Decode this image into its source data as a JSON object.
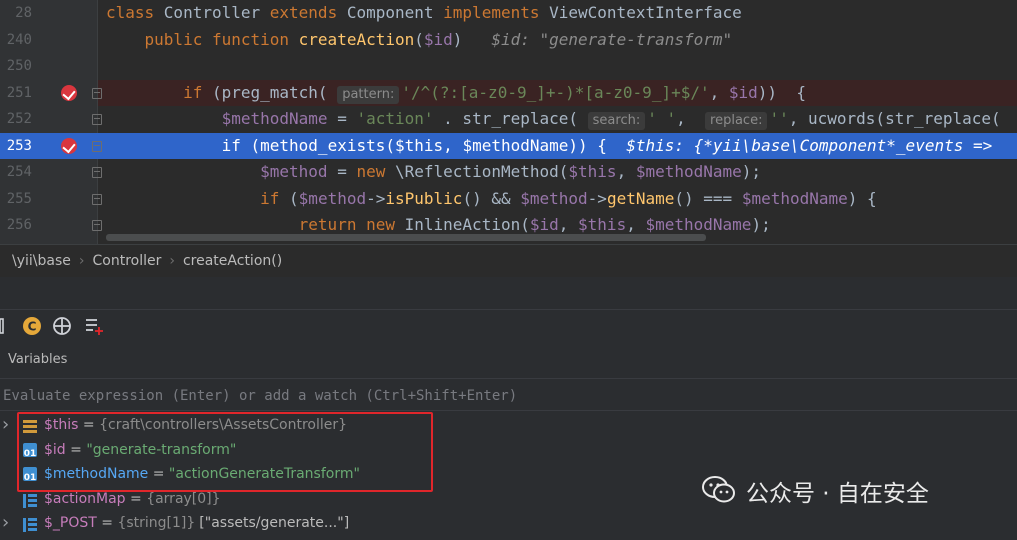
{
  "editor": {
    "lines": [
      {
        "num": "28",
        "parts": [
          [
            "kw",
            "class "
          ],
          [
            "cls",
            "Controller "
          ],
          [
            "kw",
            "extends "
          ],
          [
            "cls",
            "Component "
          ],
          [
            "kw",
            "implements "
          ],
          [
            "cls",
            "ViewContextInterface"
          ]
        ]
      },
      {
        "num": "240",
        "parts": [
          [
            "kw",
            "    public function "
          ],
          [
            "fn",
            "createAction"
          ],
          [
            "cls",
            "("
          ],
          [
            "var",
            "$id"
          ],
          [
            "cls",
            ")"
          ],
          [
            "inline",
            "   $id: \"generate-transform\""
          ]
        ]
      },
      {
        "num": "250",
        "parts": []
      },
      {
        "num": "251",
        "parts": [
          [
            "kw",
            "        if "
          ],
          [
            "cls",
            "(preg_match( "
          ],
          [
            "hint",
            "pattern:"
          ],
          [
            "str",
            "'/^(?:[a-z0-9_]+-)*[a-z0-9_]+$/'"
          ],
          [
            "cls",
            ", "
          ],
          [
            "var",
            "$id"
          ],
          [
            "cls",
            "))  {"
          ]
        ]
      },
      {
        "num": "252",
        "parts": [
          [
            "var",
            "            $methodName"
          ],
          [
            "cls",
            " = "
          ],
          [
            "str",
            "'action'"
          ],
          [
            "cls",
            " . str_replace( "
          ],
          [
            "hint",
            "search:"
          ],
          [
            "str",
            "' '"
          ],
          [
            "cls",
            ",  "
          ],
          [
            "hint",
            "replace:"
          ],
          [
            "str",
            "''"
          ],
          [
            "cls",
            ", ucwords(str_replace("
          ]
        ]
      },
      {
        "num": "253",
        "parts": [
          [
            "kw",
            "            if "
          ],
          [
            "cls",
            "(method_exists("
          ],
          [
            "var",
            "$this"
          ],
          [
            "cls",
            ", "
          ],
          [
            "var",
            "$methodName"
          ],
          [
            "cls",
            ")) {  "
          ],
          [
            "inline",
            "$this: {*yii\\base\\Component*_events =>"
          ]
        ]
      },
      {
        "num": "254",
        "parts": [
          [
            "var",
            "                $method"
          ],
          [
            "cls",
            " = "
          ],
          [
            "kw",
            "new "
          ],
          [
            "cls",
            "\\ReflectionMethod("
          ],
          [
            "var",
            "$this"
          ],
          [
            "cls",
            ", "
          ],
          [
            "var",
            "$methodName"
          ],
          [
            "cls",
            ");"
          ]
        ]
      },
      {
        "num": "255",
        "parts": [
          [
            "kw",
            "                if "
          ],
          [
            "cls",
            "("
          ],
          [
            "var",
            "$method"
          ],
          [
            "cls",
            "->"
          ],
          [
            "fn",
            "isPublic"
          ],
          [
            "cls",
            "() && "
          ],
          [
            "var",
            "$method"
          ],
          [
            "cls",
            "->"
          ],
          [
            "fn",
            "getName"
          ],
          [
            "cls",
            "() === "
          ],
          [
            "var",
            "$methodName"
          ],
          [
            "cls",
            ") {"
          ]
        ]
      },
      {
        "num": "256",
        "parts": [
          [
            "kw",
            "                    return new "
          ],
          [
            "cls",
            "InlineAction("
          ],
          [
            "var",
            "$id"
          ],
          [
            "cls",
            ", "
          ],
          [
            "var",
            "$this"
          ],
          [
            "cls",
            ", "
          ],
          [
            "var",
            "$methodName"
          ],
          [
            "cls",
            ");"
          ]
        ]
      }
    ]
  },
  "breadcrumb": [
    "\\yii\\base",
    "Controller",
    "createAction()"
  ],
  "variables": {
    "title": "Variables",
    "evaluate_placeholder": "Evaluate expression (Enter) or add a watch (Ctrl+Shift+Enter)",
    "rows": [
      {
        "name": "$this",
        "eq": " = ",
        "type": "{craft\\controllers\\AssetsController}",
        "value": "",
        "icon": "object-icon",
        "expandable": true,
        "hl": false
      },
      {
        "name": "$id",
        "eq": " = ",
        "type": "",
        "value": "\"generate-transform\"",
        "icon": "string-icon",
        "expandable": false,
        "hl": false
      },
      {
        "name": "$methodName",
        "eq": " = ",
        "type": "",
        "value": "\"actionGenerateTransform\"",
        "icon": "string-icon",
        "expandable": false,
        "hl": true
      },
      {
        "name": "$actionMap",
        "eq": " = ",
        "type": "{array[0]}",
        "value": "",
        "icon": "array-icon",
        "expandable": false,
        "hl": false
      },
      {
        "name": "$_POST",
        "eq": " = ",
        "type": "{string[1]}",
        "value": "[\"assets/generate...\"]",
        "icon": "array-icon",
        "expandable": true,
        "hl": false
      }
    ]
  },
  "watermark": "公众号 · 自在安全",
  "colors": {
    "breakpoint": "#d9363e",
    "highlight": "#2f65ca",
    "annotation_box": "#e0262b"
  }
}
